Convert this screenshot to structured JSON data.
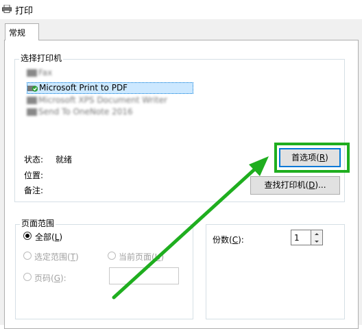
{
  "window": {
    "title": "打印"
  },
  "tabs": [
    {
      "label": "常规"
    }
  ],
  "select_printer": {
    "label": "选择打印机",
    "printers": [
      {
        "name": "Fax",
        "selected": false,
        "blurred": true
      },
      {
        "name": "Microsoft Print to PDF",
        "selected": true,
        "blurred": false
      },
      {
        "name": "Microsoft XPS Document Writer",
        "selected": false,
        "blurred": true
      },
      {
        "name": "Send To OneNote 2016",
        "selected": false,
        "blurred": true
      }
    ],
    "status_label": "状态:",
    "status_value": "就绪",
    "location_label": "位置:",
    "comment_label": "备注:",
    "preferences_button": {
      "text": "首选项(",
      "mnemonic": "R",
      "suffix": ")"
    },
    "find_printer_button": {
      "text": "查找打印机(",
      "mnemonic": "D",
      "suffix": ")..."
    }
  },
  "page_range": {
    "label": "页面范围",
    "all": {
      "text": "全部(",
      "mnemonic": "L",
      "suffix": ")",
      "checked": true
    },
    "selection": {
      "text": "选定范围(",
      "mnemonic": "T",
      "suffix": ")",
      "enabled": false
    },
    "current_page": {
      "text": "当前页面(",
      "mnemonic": "U",
      "suffix": ")",
      "enabled": false
    },
    "pages": {
      "text": "页码(",
      "mnemonic": "G",
      "suffix": "):",
      "enabled": false,
      "value": ""
    }
  },
  "copies": {
    "label_text": "份数(",
    "label_mnemonic": "C",
    "label_suffix": "):",
    "value": "1"
  },
  "annotation": {
    "highlight_color": "#1fae1f"
  }
}
